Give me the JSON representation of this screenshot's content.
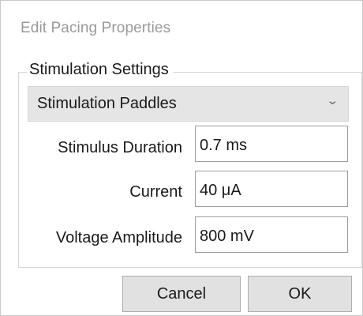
{
  "dialog": {
    "title": "Edit Pacing Properties"
  },
  "group": {
    "title": "Stimulation Settings",
    "mode_select": {
      "selected": "Stimulation Paddles",
      "arrow_icon": "chevron-down-icon"
    },
    "fields": [
      {
        "label": "Stimulus Duration",
        "value": "0.7 ms"
      },
      {
        "label": "Current",
        "value": "40 μA"
      },
      {
        "label": "Voltage Amplitude",
        "value": "800 mV"
      }
    ]
  },
  "buttons": {
    "cancel_label": "Cancel",
    "ok_label": "OK"
  },
  "colors": {
    "title_text": "#9a9a9a",
    "button_bg": "#e1e1e1",
    "dropdown_bg": "#e5e5e5"
  }
}
